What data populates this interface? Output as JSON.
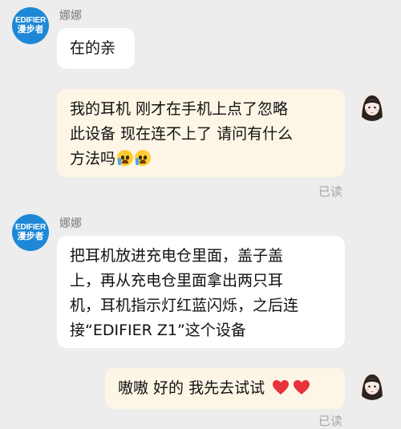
{
  "messages": [
    {
      "sender": "娜娜",
      "avatar": {
        "line1": "EDIFIER",
        "line2": "漫步者"
      },
      "text": "在的亲"
    },
    {
      "text": "我的耳机 刚才在手机上点了忽略此设备 现在连不上了 请问有什么方法吗",
      "line1": "我的耳机 刚才在手机上点了忽略",
      "line2": "此设备 现在连不上了 请问有什么",
      "line3": "方法吗",
      "emoji": "loudly-crying-face-icon",
      "read": "已读"
    },
    {
      "sender": "娜娜",
      "avatar": {
        "line1": "EDIFIER",
        "line2": "漫步者"
      },
      "line1": "把耳机放进充电仓里面，盖子盖",
      "line2": "上，再从充电仓里面拿出两只耳",
      "line3": "机，耳机指示灯红蓝闪烁，之后连",
      "line4": "接“EDIFIER Z1”这个设备"
    },
    {
      "text": "嗷嗷 好的 我先去试试",
      "emoji": "red-heart-icon",
      "read": "已读"
    }
  ],
  "colors": {
    "background": "#ededed",
    "incoming_bubble": "#ffffff",
    "outgoing_bubble": "#fdf6e6",
    "brand_avatar": "#1e88d6",
    "read_status": "#a6a6a6"
  }
}
